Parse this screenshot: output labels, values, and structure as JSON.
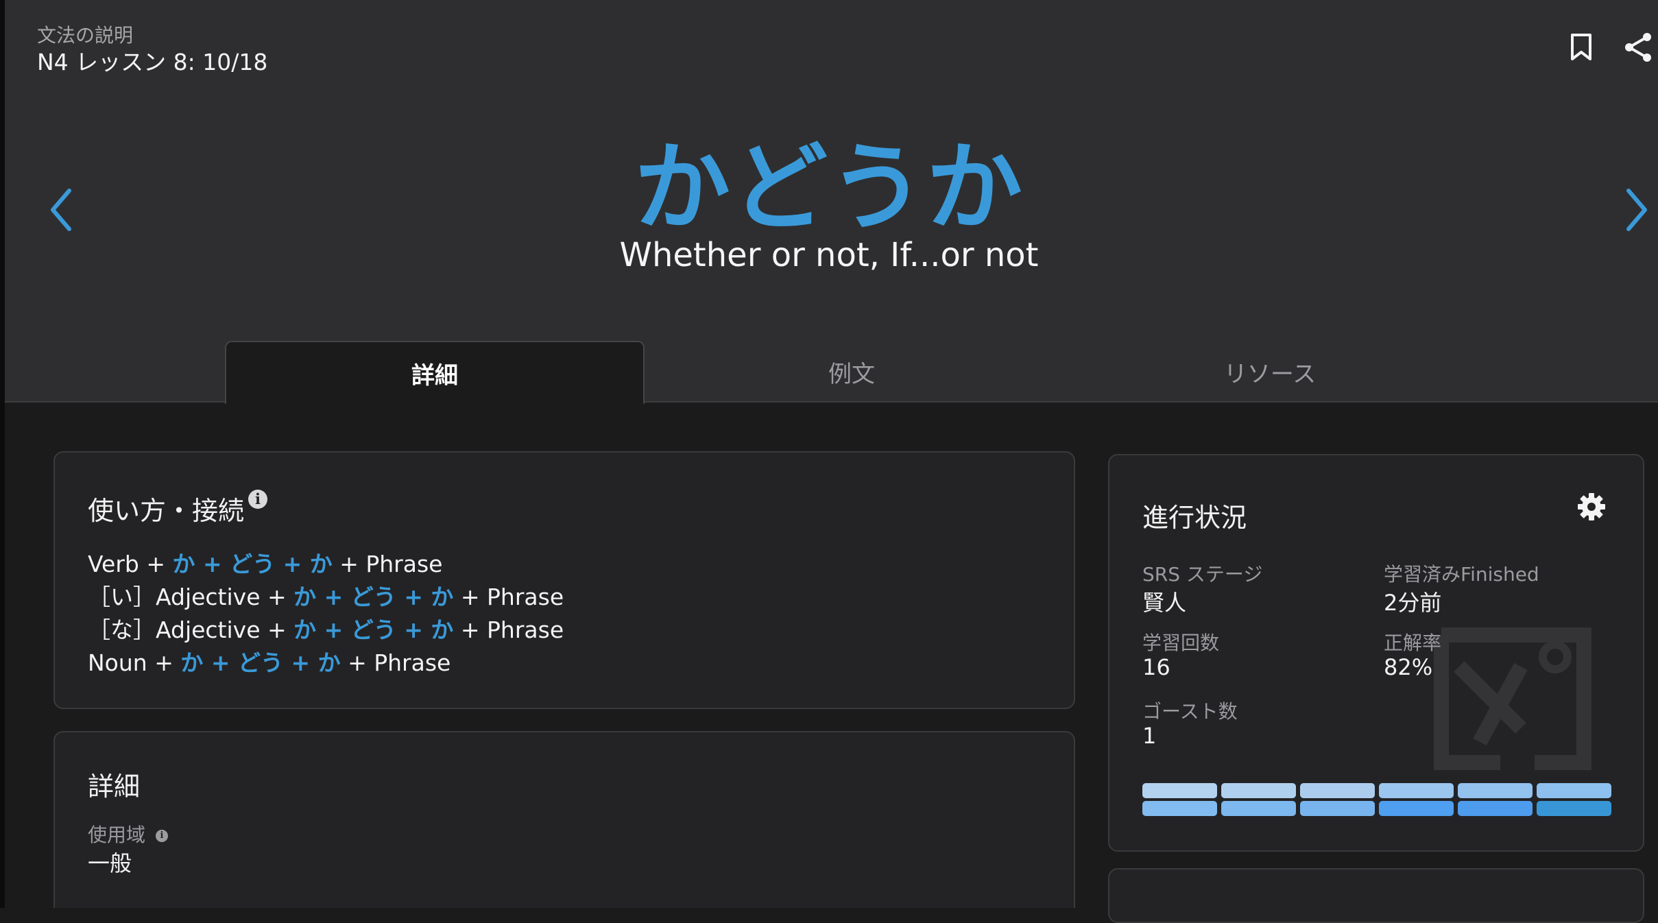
{
  "header": {
    "category": "文法の説明",
    "lesson": "N4 レッスン 8: 10/18"
  },
  "grammar": {
    "title": "かどうか",
    "meaning": "Whether or not, If...or not"
  },
  "tabs": [
    "詳細",
    "例文",
    "リソース"
  ],
  "usage": {
    "title": "使い方・接続",
    "formulas": [
      {
        "prefix": "Verb + ",
        "pattern": "か + どう + か",
        "suffix": " + Phrase"
      },
      {
        "prefix": "［い］Adjective + ",
        "pattern": "か + どう + か",
        "suffix": " + Phrase"
      },
      {
        "prefix": "［な］Adjective + ",
        "pattern": "か + どう + か",
        "suffix": " + Phrase"
      },
      {
        "prefix": "Noun + ",
        "pattern": "か + どう + か",
        "suffix": " + Phrase"
      }
    ]
  },
  "details": {
    "title": "詳細",
    "register_label": "使用域",
    "register_value": "一般"
  },
  "progress": {
    "title": "進行状況",
    "srs_label": "SRS ステージ",
    "srs_value": "賢人",
    "studied_label": "学習済みFinished",
    "studied_value": "2分前",
    "reviews_label": "学習回数",
    "reviews_value": "16",
    "accuracy_label": "正解率",
    "accuracy_value": "82%",
    "ghost_label": "ゴースト数",
    "ghost_value": "1",
    "stage_colors": [
      [
        "#b3d2f0",
        "#b0d0ef",
        "#acccee",
        "#9ac6f0",
        "#93c2ef",
        "#8dc0ef"
      ],
      [
        "#82bbef",
        "#7db8ee",
        "#78b5ee",
        "#4f9ff0",
        "#4e9cee",
        "#3896d6"
      ]
    ]
  },
  "colors": {
    "accent": "#3a9ad9",
    "header_bg": "#2e2e30",
    "body_bg": "#1b1b1c"
  },
  "icons": {
    "bookmark": "bookmark-icon",
    "share": "share-icon",
    "prev": "chevron-left-icon",
    "next": "chevron-right-icon",
    "settings": "gear-icon",
    "info": "info-icon",
    "logo": "bunpro-logo-watermark"
  }
}
